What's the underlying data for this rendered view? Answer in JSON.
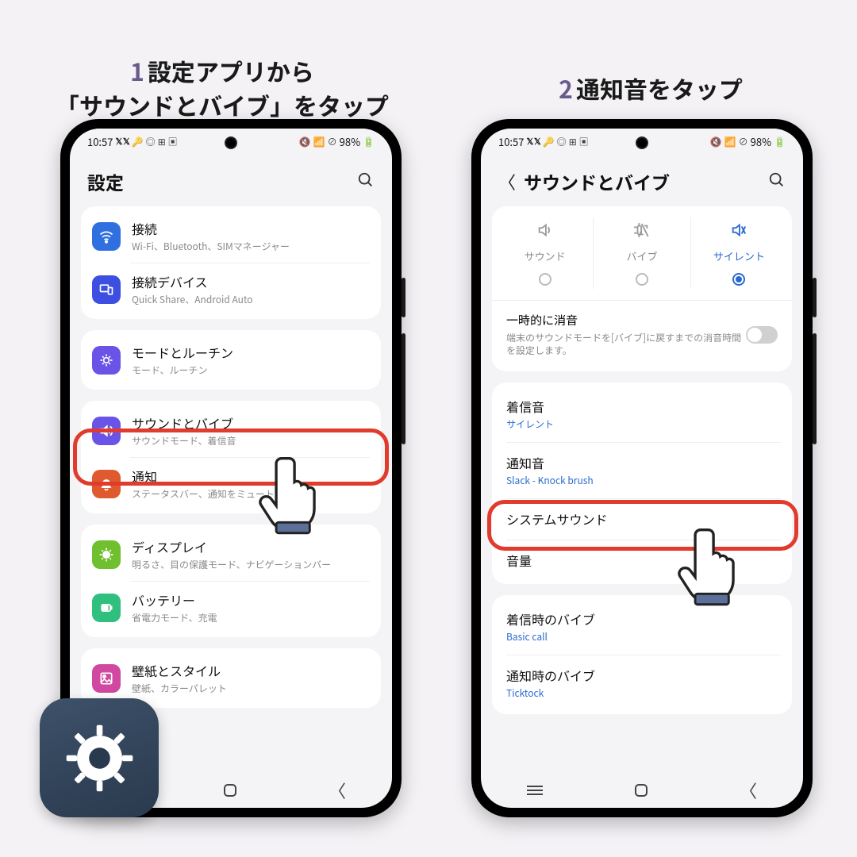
{
  "captions": {
    "step1_num": "1",
    "step1": "設定アプリから\n「サウンドとバイブ」をタップ",
    "step2_num": "2",
    "step2": "通知音をタップ"
  },
  "status": {
    "time": "10:57",
    "battery": "98%"
  },
  "phone1": {
    "header_title": "設定",
    "groups": [
      {
        "items": [
          {
            "icon": "wifi",
            "bg": "#2f6fe0",
            "title": "接続",
            "sub": "Wi-Fi、Bluetooth、SIMマネージャー"
          },
          {
            "icon": "devices",
            "bg": "#3c4fe0",
            "title": "接続デバイス",
            "sub": "Quick Share、Android Auto"
          }
        ]
      },
      {
        "items": [
          {
            "icon": "routine",
            "bg": "#6a54e8",
            "title": "モードとルーチン",
            "sub": "モード、ルーチン"
          }
        ]
      },
      {
        "items": [
          {
            "icon": "sound",
            "bg": "#6a54e8",
            "title": "サウンドとバイブ",
            "sub": "サウンドモード、着信音"
          },
          {
            "icon": "notif",
            "bg": "#e05a2f",
            "title": "通知",
            "sub": "ステータスバー、通知をミュート"
          }
        ]
      },
      {
        "items": [
          {
            "icon": "display",
            "bg": "#6fbf2f",
            "title": "ディスプレイ",
            "sub": "明るさ、目の保護モード、ナビゲーションバー"
          },
          {
            "icon": "battery",
            "bg": "#2fbf7f",
            "title": "バッテリー",
            "sub": "省電力モード、充電"
          }
        ]
      },
      {
        "items": [
          {
            "icon": "wall",
            "bg": "#d048a0",
            "title": "壁紙とスタイル",
            "sub": "壁紙、カラーパレット"
          }
        ]
      }
    ]
  },
  "phone2": {
    "header_title": "サウンドとバイブ",
    "modes": [
      {
        "label": "サウンド"
      },
      {
        "label": "バイブ"
      },
      {
        "label": "サイレント",
        "active": true
      }
    ],
    "mute": {
      "title": "一時的に消音",
      "sub": "端末のサウンドモードを[バイブ]に戻すまでの消音時間を設定します。"
    },
    "list1": [
      {
        "title": "着信音",
        "sub": "サイレント",
        "link": true
      },
      {
        "title": "通知音",
        "sub": "Slack - Knock brush",
        "link": true
      },
      {
        "title": "システムサウンド"
      },
      {
        "title": "音量"
      }
    ],
    "list2": [
      {
        "title": "着信時のバイブ",
        "sub": "Basic call",
        "link": true
      },
      {
        "title": "通知時のバイブ",
        "sub": "Ticktock",
        "link": true
      }
    ]
  }
}
